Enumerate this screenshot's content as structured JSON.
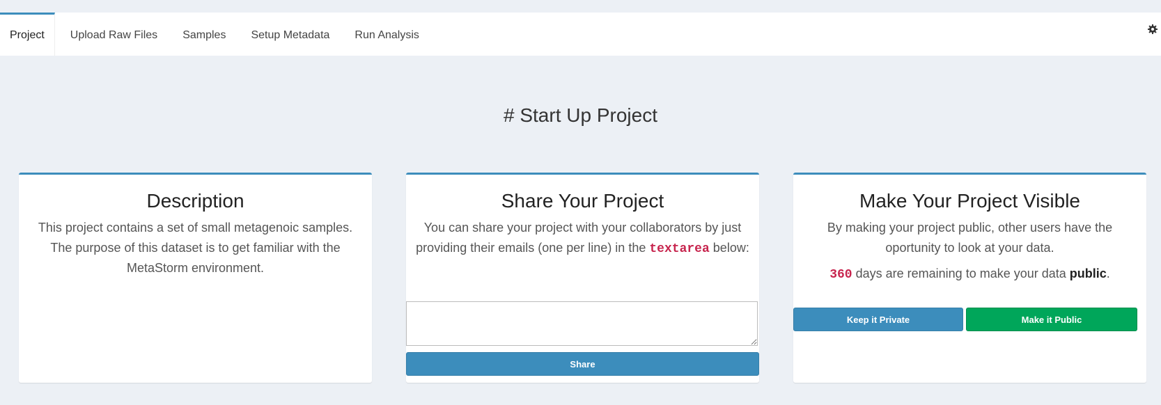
{
  "tabs": [
    {
      "label": "Project"
    },
    {
      "label": "Upload Raw Files"
    },
    {
      "label": "Samples"
    },
    {
      "label": "Setup Metadata"
    },
    {
      "label": "Run Analysis"
    }
  ],
  "page_title": "# Start Up Project",
  "description": {
    "title": "Description",
    "text": "This project contains a set of small metagenoic samples. The purpose of this dataset is to get familiar with the MetaStorm environment."
  },
  "share": {
    "title": "Share Your Project",
    "text_before": "You can share your project with your collaborators by just providing their emails (one per line) in the",
    "code": "textarea",
    "text_after": "below:",
    "textarea_value": "",
    "button_label": "Share"
  },
  "visibility": {
    "title": "Make Your Project Visible",
    "text": "By making your project public, other users have the oportunity to look at your data.",
    "days": "360",
    "days_text": "days are remaining to make your data",
    "public_word": "public",
    "period": ".",
    "private_button": "Keep it Private",
    "public_button": "Make it Public"
  },
  "colors": {
    "accent": "#3c8dbc",
    "green": "#00a65a",
    "background": "#ecf0f5"
  },
  "icons": {
    "settings": "gear-icon"
  }
}
